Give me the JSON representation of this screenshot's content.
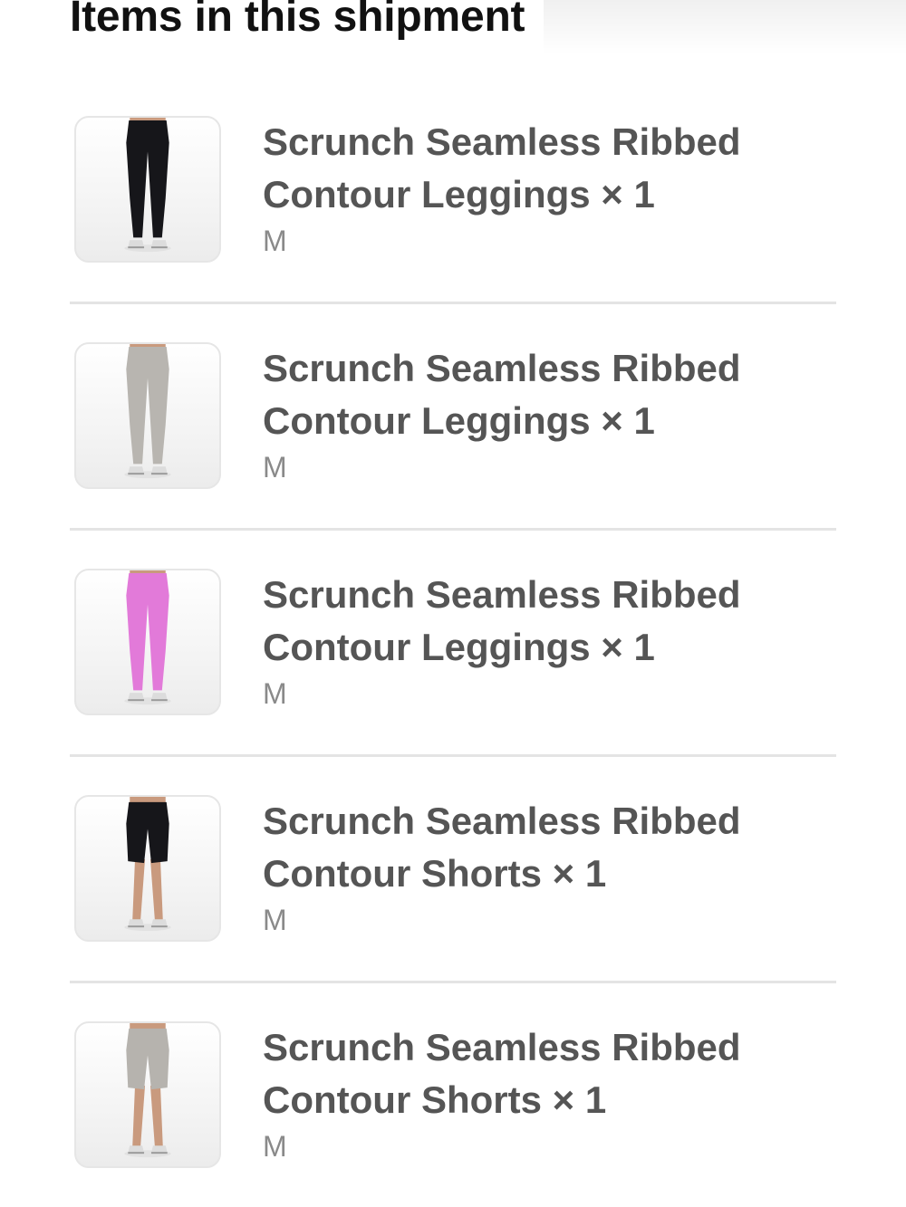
{
  "header": {
    "title": "Items in this shipment"
  },
  "items": [
    {
      "name_line1": "Scrunch Seamless Ribbed",
      "name_line2": "Contour Leggings × 1",
      "size": "M",
      "product_color": "#16161a",
      "style": "leggings",
      "image_icon": "leggings-product-icon"
    },
    {
      "name_line1": "Scrunch Seamless Ribbed",
      "name_line2": "Contour Leggings × 1",
      "size": "M",
      "product_color": "#b8b5b0",
      "style": "leggings",
      "image_icon": "leggings-product-icon"
    },
    {
      "name_line1": "Scrunch Seamless Ribbed",
      "name_line2": "Contour Leggings × 1",
      "size": "M",
      "product_color": "#e27ad9",
      "style": "leggings",
      "image_icon": "leggings-product-icon"
    },
    {
      "name_line1": "Scrunch Seamless Ribbed",
      "name_line2": "Contour Shorts × 1",
      "size": "M",
      "product_color": "#16161a",
      "style": "shorts",
      "image_icon": "shorts-product-icon"
    },
    {
      "name_line1": "Scrunch Seamless Ribbed",
      "name_line2": "Contour Shorts × 1",
      "size": "M",
      "product_color": "#b6b3ae",
      "style": "shorts",
      "image_icon": "shorts-product-icon"
    }
  ]
}
